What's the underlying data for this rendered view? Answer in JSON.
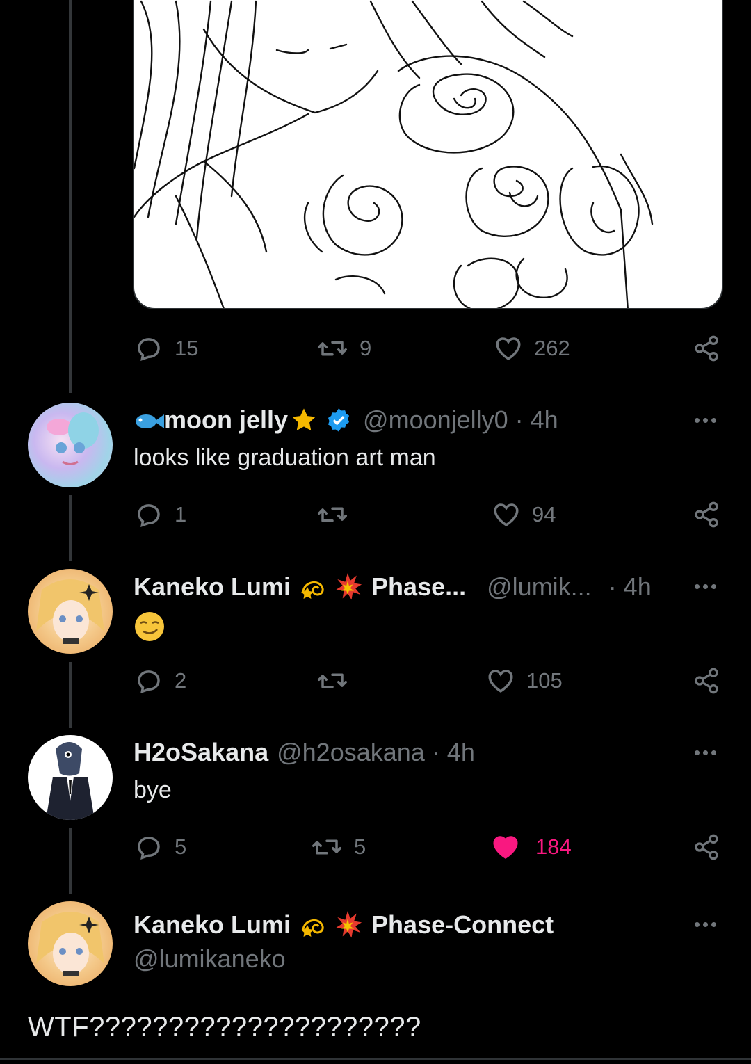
{
  "main_post": {
    "stats": {
      "replies": "15",
      "reposts": "9",
      "likes": "262"
    }
  },
  "replies": [
    {
      "name": "moon jelly",
      "handle": "@moonjelly0 · 4h",
      "text": "looks like graduation art man",
      "stats": {
        "replies": "1",
        "reposts": "",
        "likes": "94"
      }
    },
    {
      "name": "Kaneko Lumi",
      "name_suffix": "Phase...",
      "handle": "@lumik...",
      "time": "· 4h",
      "text": "😏",
      "stats": {
        "replies": "2",
        "reposts": "",
        "likes": "105"
      }
    },
    {
      "name": "H2oSakana",
      "handle": "@h2osakana · 4h",
      "text": "bye",
      "stats": {
        "replies": "5",
        "reposts": "5",
        "likes": "184"
      },
      "liked": true
    }
  ],
  "focus_post": {
    "name": "Kaneko Lumi",
    "name_suffix": "Phase-Connect",
    "handle": "@lumikaneko",
    "text": "WTF?????????????????????"
  },
  "colors": {
    "background": "#000000",
    "muted": "#71767b",
    "like_active": "#f91880",
    "verified": "#1d9bf0"
  },
  "icons": [
    "reply-icon",
    "repost-icon",
    "like-icon",
    "share-icon",
    "more-icon",
    "verified-icon",
    "fish-emoji",
    "star-emoji",
    "dizzy-emoji",
    "collision-emoji"
  ]
}
